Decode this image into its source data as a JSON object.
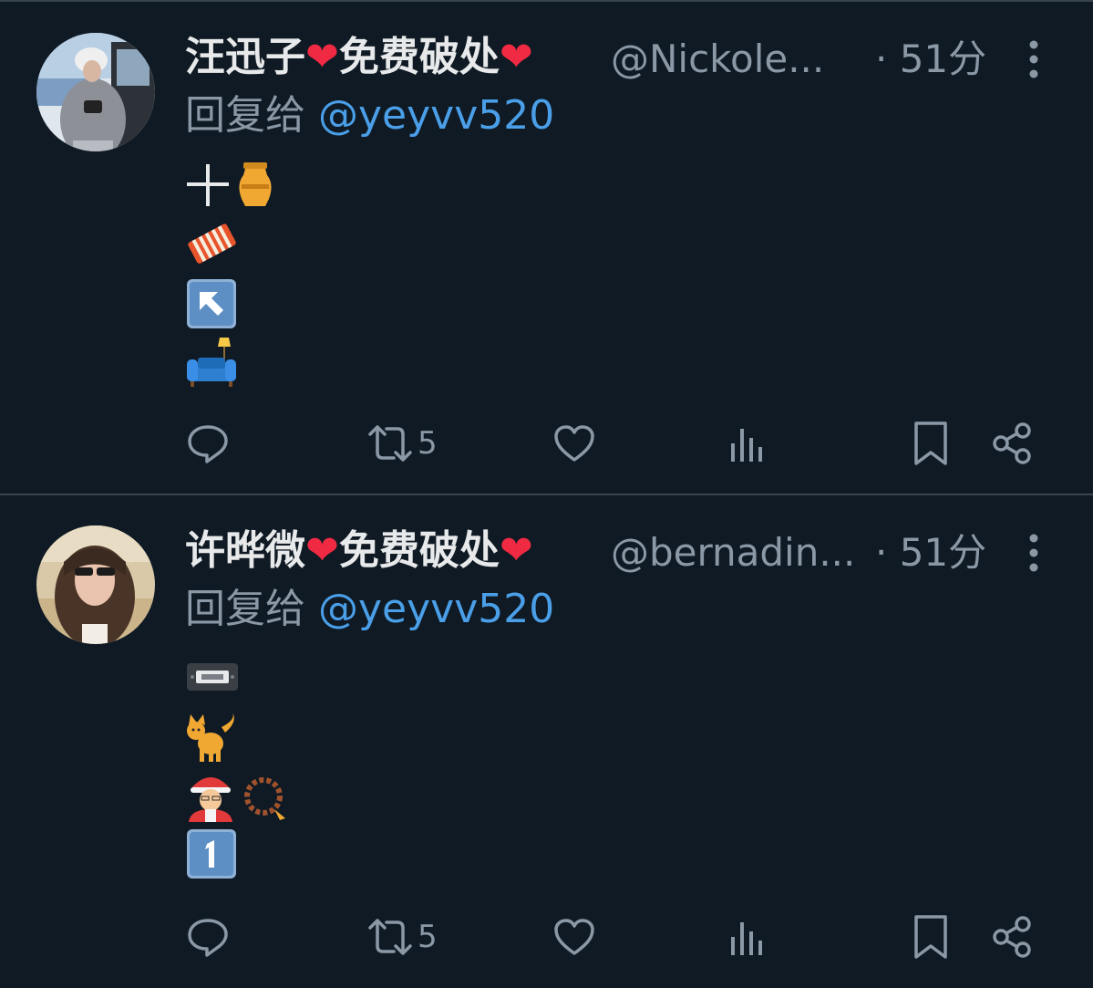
{
  "tweets": [
    {
      "name_1": "汪迅子",
      "name_2": "免费破处",
      "handle": "@Nickole...",
      "time": "· 51分",
      "reply_prefix": "回复给",
      "reply_mention": "@yeyvv520",
      "emoji_lines": [
        [
          "plus-icon",
          "funeral-urn-icon"
        ],
        [
          "accordion-icon"
        ],
        [
          "up-left-arrow-icon"
        ],
        [
          "couch-and-lamp-icon"
        ]
      ],
      "retweet_count": "5"
    },
    {
      "name_1": "许晔微",
      "name_2": "免费破处",
      "handle": "@bernadin...",
      "time": "· 51分",
      "reply_prefix": "回复给",
      "reply_mention": "@yeyvv520",
      "emoji_lines": [
        [
          "videocassette-icon"
        ],
        [
          "cat-icon"
        ],
        [
          "mrs-claus-icon",
          "prayer-beads-icon"
        ],
        [
          "keycap-one-icon"
        ]
      ],
      "retweet_count": "5"
    }
  ],
  "colors": {
    "background": "#0f1a24",
    "divider": "#38444d",
    "text": "#e7e9ea",
    "muted": "#8b98a5",
    "mention": "#4a9fe8",
    "heart": "#f02a42"
  }
}
